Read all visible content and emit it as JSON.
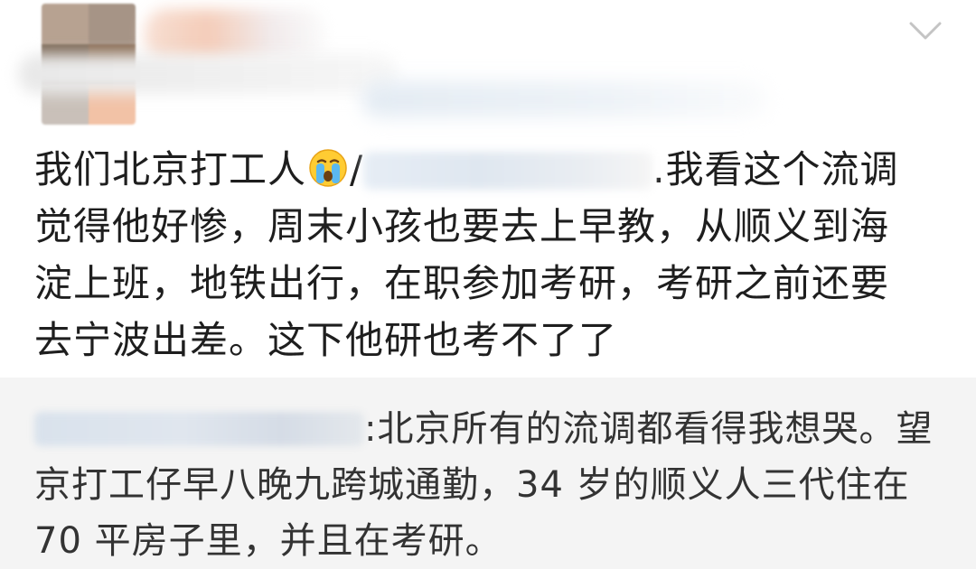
{
  "post": {
    "body_line1_prefix": "我们北京打工人",
    "slash": "/",
    "body_line1_suffix": ".我看这个流调",
    "body_line2": "觉得他好惨，周末小孩也要去上早教，从顺义到海",
    "body_line3": "淀上班，地铁出行，在职参加考研，考研之前还要",
    "body_line4": "去宁波出差。这下他研也考不了了",
    "emoji_name": "crying-face-emoji"
  },
  "repost": {
    "line1_text": ":北京所有的流调都看得我想哭。望",
    "line2": "京打工仔早八晚九跨城通勤，34 岁的顺义人三代住在",
    "line3": "70 平房子里，并且在考研。"
  },
  "colors": {
    "text": "#1e1e1e",
    "repost_text": "#333333",
    "repost_bg": "#f4f4f4",
    "chevron": "#c4c4c4"
  }
}
